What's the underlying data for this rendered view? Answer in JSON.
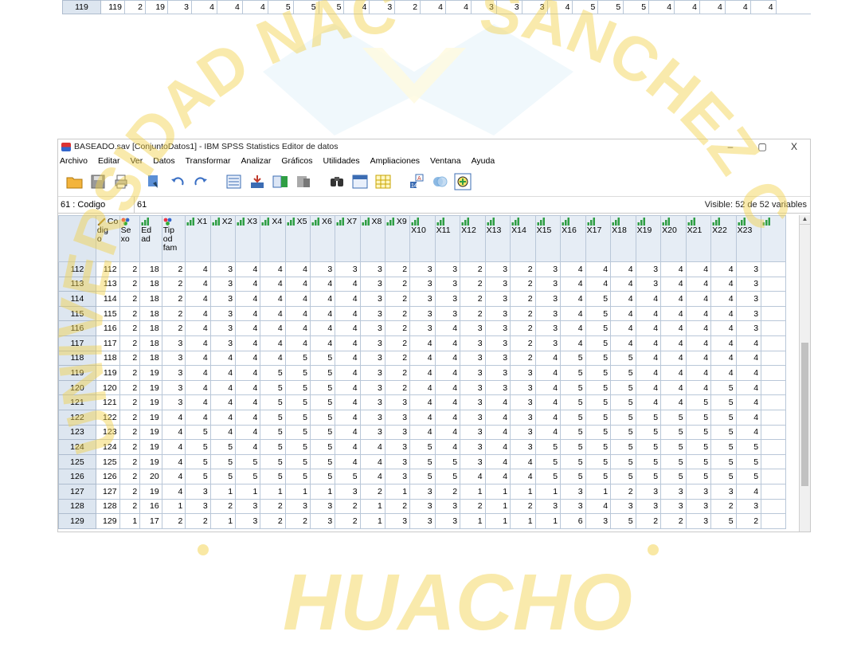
{
  "top_row": {
    "row": "119",
    "values": [
      "119",
      "2",
      "19",
      "3",
      "4",
      "4",
      "4",
      "5",
      "5",
      "5",
      "4",
      "3",
      "2",
      "4",
      "4",
      "3",
      "3",
      "3",
      "4",
      "5",
      "5",
      "5",
      "4",
      "4",
      "4",
      "4",
      "4"
    ]
  },
  "watermark": {
    "arc_text": "UNIVERSIDAD NACIONAL JOSÉ FAUSTINO SÁNCHEZ CARRIÓN",
    "city": "HUACHO",
    "color": "#f3d24a"
  },
  "window": {
    "title": "BASEADO.sav [ConjuntoDatos1] - IBM SPSS Statistics Editor de datos",
    "min": "–",
    "max": "▢",
    "close": "X"
  },
  "menu": [
    "Archivo",
    "Editar",
    "Ver",
    "Datos",
    "Transformar",
    "Analizar",
    "Gráficos",
    "Utilidades",
    "Ampliaciones",
    "Ventana",
    "Ayuda"
  ],
  "toolbar_icons": [
    "open-folder-icon",
    "save-icon",
    "print-icon",
    "dialog-recall-icon",
    "undo-icon",
    "redo-icon",
    "goto-case-icon",
    "goto-variable-icon",
    "variables-icon",
    "run-descriptive-icon",
    "find-icon",
    "insert-cases-icon",
    "insert-variable-icon",
    "split-file-icon",
    "weight-cases-icon",
    "select-cases-icon"
  ],
  "cellbar": {
    "ref": "61 : Codigo",
    "value": "61",
    "visible": "Visible: 52 de 52 variables"
  },
  "columns": [
    {
      "name": "Co\ndig\no",
      "icon": "ruler"
    },
    {
      "name": "Se\nxo",
      "icon": "nominal"
    },
    {
      "name": "Ed\nad",
      "icon": "scale"
    },
    {
      "name": "Tip\nod\nfam",
      "icon": "nominal"
    },
    {
      "name": "X1",
      "icon": "scale"
    },
    {
      "name": "X2",
      "icon": "scale"
    },
    {
      "name": "X3",
      "icon": "scale"
    },
    {
      "name": "X4",
      "icon": "scale"
    },
    {
      "name": "X5",
      "icon": "scale"
    },
    {
      "name": "X6",
      "icon": "scale"
    },
    {
      "name": "X7",
      "icon": "scale"
    },
    {
      "name": "X8",
      "icon": "scale"
    },
    {
      "name": "X9",
      "icon": "scale"
    },
    {
      "name": "X10",
      "icon": "scale"
    },
    {
      "name": "X11",
      "icon": "scale"
    },
    {
      "name": "X12",
      "icon": "scale"
    },
    {
      "name": "X13",
      "icon": "scale"
    },
    {
      "name": "X14",
      "icon": "scale"
    },
    {
      "name": "X15",
      "icon": "scale"
    },
    {
      "name": "X16",
      "icon": "scale"
    },
    {
      "name": "X17",
      "icon": "scale"
    },
    {
      "name": "X18",
      "icon": "scale"
    },
    {
      "name": "X19",
      "icon": "scale"
    },
    {
      "name": "X20",
      "icon": "scale"
    },
    {
      "name": "X21",
      "icon": "scale"
    },
    {
      "name": "X22",
      "icon": "scale"
    },
    {
      "name": "X23",
      "icon": "scale"
    },
    {
      "name": "",
      "icon": "scale"
    }
  ],
  "rows": [
    {
      "row": "112",
      "values": [
        "112",
        "2",
        "18",
        "2",
        "4",
        "3",
        "4",
        "4",
        "4",
        "3",
        "3",
        "3",
        "2",
        "3",
        "3",
        "2",
        "3",
        "2",
        "3",
        "4",
        "4",
        "4",
        "3",
        "4",
        "4",
        "4",
        "3",
        ""
      ]
    },
    {
      "row": "113",
      "values": [
        "113",
        "2",
        "18",
        "2",
        "4",
        "3",
        "4",
        "4",
        "4",
        "4",
        "4",
        "3",
        "2",
        "3",
        "3",
        "2",
        "3",
        "2",
        "3",
        "4",
        "4",
        "4",
        "3",
        "4",
        "4",
        "4",
        "3",
        ""
      ]
    },
    {
      "row": "114",
      "values": [
        "114",
        "2",
        "18",
        "2",
        "4",
        "3",
        "4",
        "4",
        "4",
        "4",
        "4",
        "3",
        "2",
        "3",
        "3",
        "2",
        "3",
        "2",
        "3",
        "4",
        "5",
        "4",
        "4",
        "4",
        "4",
        "4",
        "3",
        ""
      ]
    },
    {
      "row": "115",
      "values": [
        "115",
        "2",
        "18",
        "2",
        "4",
        "3",
        "4",
        "4",
        "4",
        "4",
        "4",
        "3",
        "2",
        "3",
        "3",
        "2",
        "3",
        "2",
        "3",
        "4",
        "5",
        "4",
        "4",
        "4",
        "4",
        "4",
        "3",
        ""
      ]
    },
    {
      "row": "116",
      "values": [
        "116",
        "2",
        "18",
        "2",
        "4",
        "3",
        "4",
        "4",
        "4",
        "4",
        "4",
        "3",
        "2",
        "3",
        "4",
        "3",
        "3",
        "2",
        "3",
        "4",
        "5",
        "4",
        "4",
        "4",
        "4",
        "4",
        "3",
        ""
      ]
    },
    {
      "row": "117",
      "values": [
        "117",
        "2",
        "18",
        "3",
        "4",
        "3",
        "4",
        "4",
        "4",
        "4",
        "4",
        "3",
        "2",
        "4",
        "4",
        "3",
        "3",
        "2",
        "3",
        "4",
        "5",
        "4",
        "4",
        "4",
        "4",
        "4",
        "4",
        ""
      ]
    },
    {
      "row": "118",
      "values": [
        "118",
        "2",
        "18",
        "3",
        "4",
        "4",
        "4",
        "4",
        "5",
        "5",
        "4",
        "3",
        "2",
        "4",
        "4",
        "3",
        "3",
        "2",
        "4",
        "5",
        "5",
        "5",
        "4",
        "4",
        "4",
        "4",
        "4",
        ""
      ]
    },
    {
      "row": "119",
      "values": [
        "119",
        "2",
        "19",
        "3",
        "4",
        "4",
        "4",
        "5",
        "5",
        "5",
        "4",
        "3",
        "2",
        "4",
        "4",
        "3",
        "3",
        "3",
        "4",
        "5",
        "5",
        "5",
        "4",
        "4",
        "4",
        "4",
        "4",
        ""
      ]
    },
    {
      "row": "120",
      "values": [
        "120",
        "2",
        "19",
        "3",
        "4",
        "4",
        "4",
        "5",
        "5",
        "5",
        "4",
        "3",
        "2",
        "4",
        "4",
        "3",
        "3",
        "3",
        "4",
        "5",
        "5",
        "5",
        "4",
        "4",
        "4",
        "5",
        "4",
        ""
      ]
    },
    {
      "row": "121",
      "values": [
        "121",
        "2",
        "19",
        "3",
        "4",
        "4",
        "4",
        "5",
        "5",
        "5",
        "4",
        "3",
        "3",
        "4",
        "4",
        "3",
        "4",
        "3",
        "4",
        "5",
        "5",
        "5",
        "4",
        "4",
        "5",
        "5",
        "4",
        ""
      ]
    },
    {
      "row": "122",
      "values": [
        "122",
        "2",
        "19",
        "4",
        "4",
        "4",
        "4",
        "5",
        "5",
        "5",
        "4",
        "3",
        "3",
        "4",
        "4",
        "3",
        "4",
        "3",
        "4",
        "5",
        "5",
        "5",
        "5",
        "5",
        "5",
        "5",
        "4",
        ""
      ]
    },
    {
      "row": "123",
      "values": [
        "123",
        "2",
        "19",
        "4",
        "5",
        "4",
        "4",
        "5",
        "5",
        "5",
        "4",
        "3",
        "3",
        "4",
        "4",
        "3",
        "4",
        "3",
        "4",
        "5",
        "5",
        "5",
        "5",
        "5",
        "5",
        "5",
        "4",
        ""
      ]
    },
    {
      "row": "124",
      "values": [
        "124",
        "2",
        "19",
        "4",
        "5",
        "5",
        "4",
        "5",
        "5",
        "5",
        "4",
        "4",
        "3",
        "5",
        "4",
        "3",
        "4",
        "3",
        "5",
        "5",
        "5",
        "5",
        "5",
        "5",
        "5",
        "5",
        "5",
        ""
      ]
    },
    {
      "row": "125",
      "values": [
        "125",
        "2",
        "19",
        "4",
        "5",
        "5",
        "5",
        "5",
        "5",
        "5",
        "4",
        "4",
        "3",
        "5",
        "5",
        "3",
        "4",
        "4",
        "5",
        "5",
        "5",
        "5",
        "5",
        "5",
        "5",
        "5",
        "5",
        ""
      ]
    },
    {
      "row": "126",
      "values": [
        "126",
        "2",
        "20",
        "4",
        "5",
        "5",
        "5",
        "5",
        "5",
        "5",
        "5",
        "4",
        "3",
        "5",
        "5",
        "4",
        "4",
        "4",
        "5",
        "5",
        "5",
        "5",
        "5",
        "5",
        "5",
        "5",
        "5",
        ""
      ]
    },
    {
      "row": "127",
      "values": [
        "127",
        "2",
        "19",
        "4",
        "3",
        "1",
        "1",
        "1",
        "1",
        "1",
        "3",
        "2",
        "1",
        "3",
        "2",
        "1",
        "1",
        "1",
        "1",
        "3",
        "1",
        "2",
        "3",
        "3",
        "3",
        "3",
        "4",
        ""
      ]
    },
    {
      "row": "128",
      "values": [
        "128",
        "2",
        "16",
        "1",
        "3",
        "2",
        "3",
        "2",
        "3",
        "3",
        "2",
        "1",
        "2",
        "3",
        "3",
        "2",
        "1",
        "2",
        "3",
        "3",
        "4",
        "3",
        "3",
        "3",
        "3",
        "2",
        "3",
        ""
      ]
    },
    {
      "row": "129",
      "values": [
        "129",
        "1",
        "17",
        "2",
        "2",
        "1",
        "3",
        "2",
        "2",
        "3",
        "2",
        "1",
        "3",
        "3",
        "3",
        "1",
        "1",
        "1",
        "1",
        "6",
        "3",
        "5",
        "2",
        "2",
        "3",
        "5",
        "2",
        ""
      ]
    }
  ]
}
